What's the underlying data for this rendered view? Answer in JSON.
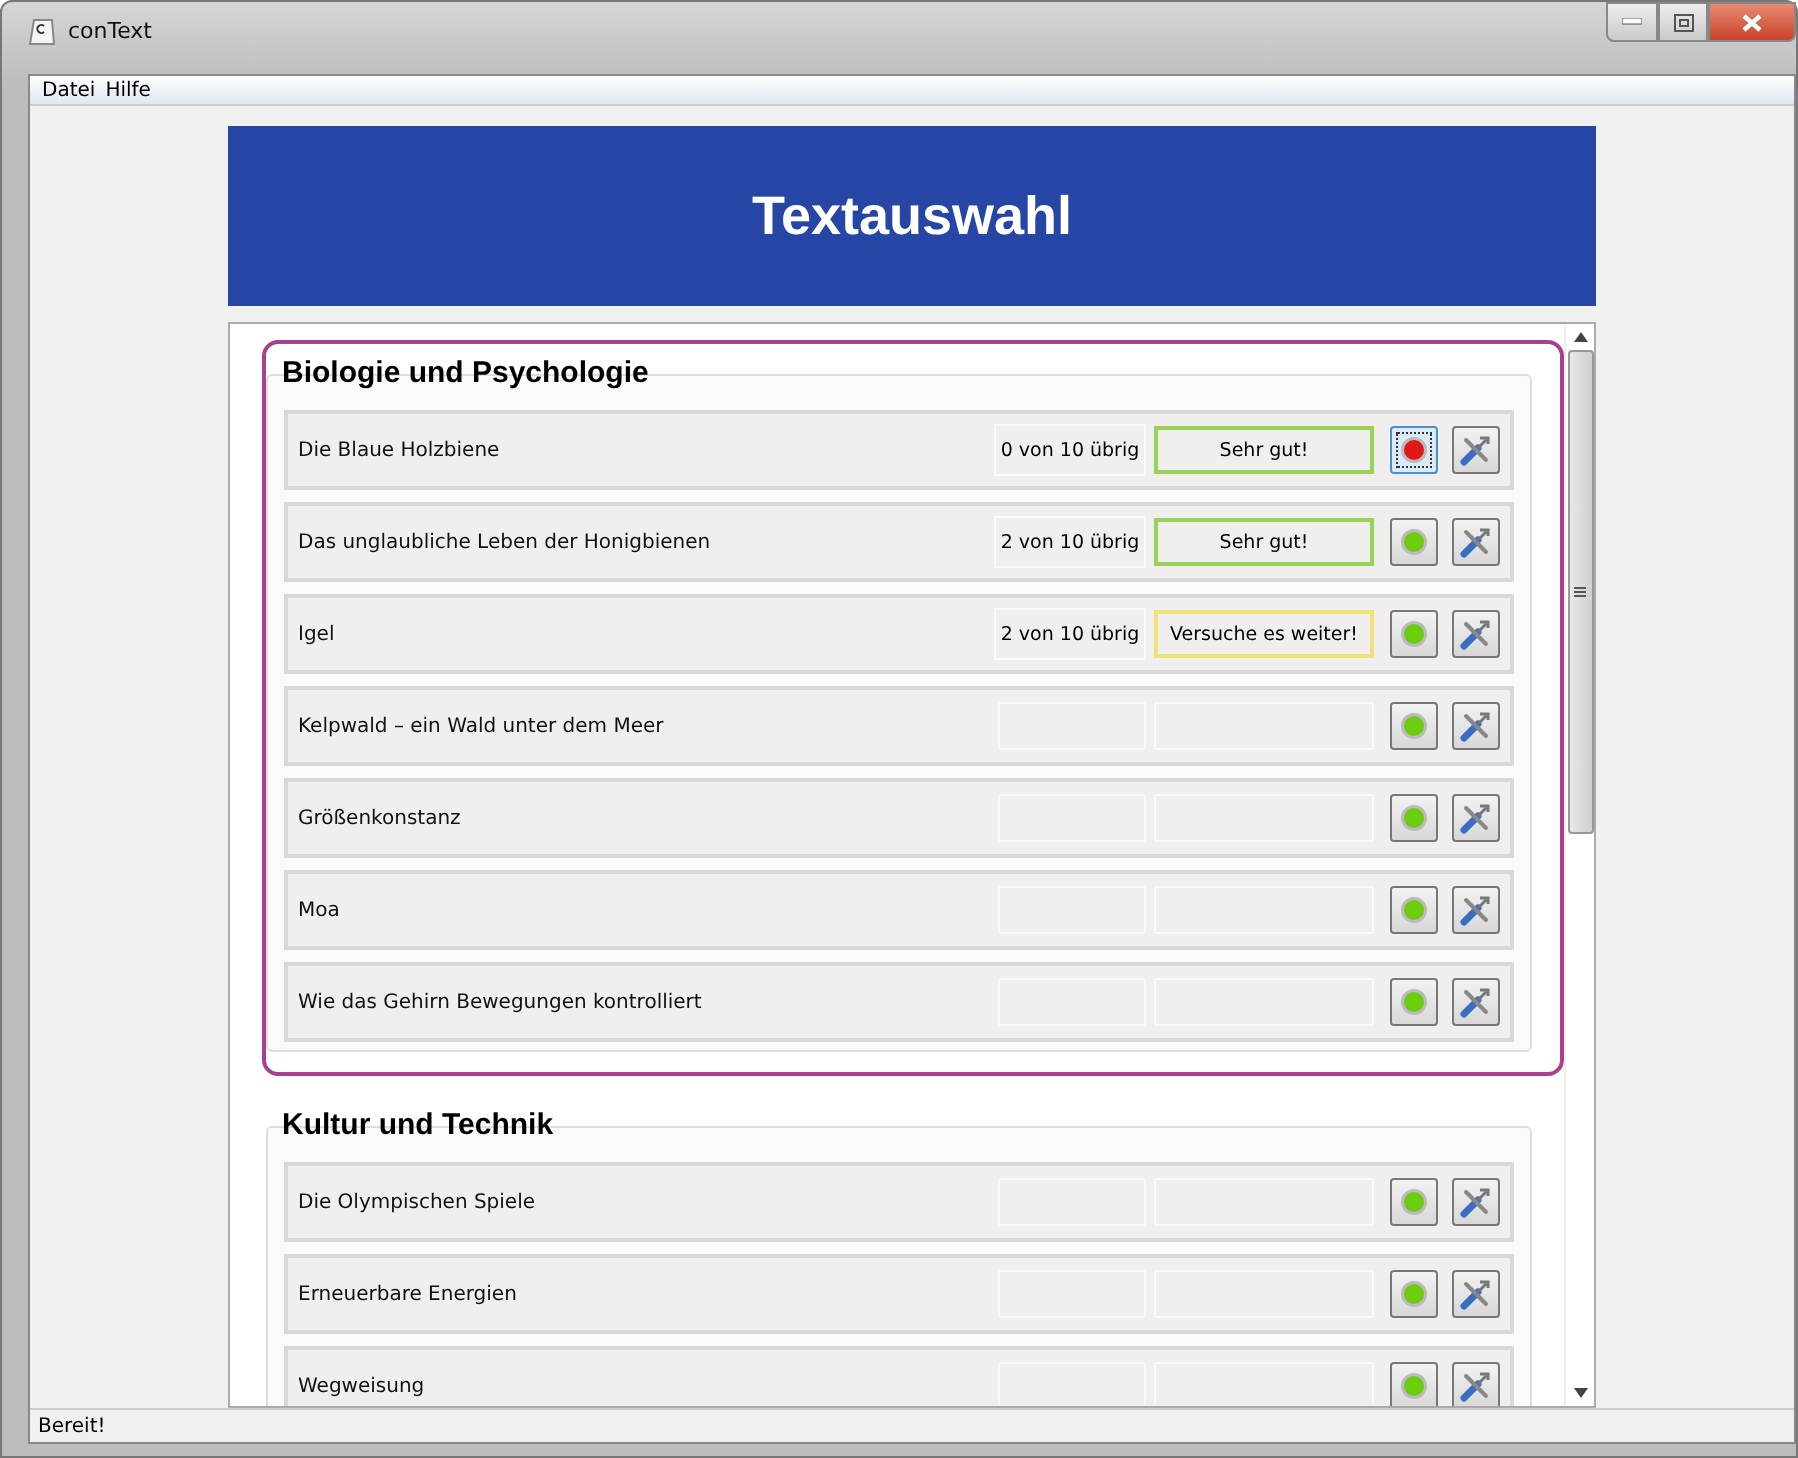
{
  "window": {
    "title": "conText"
  },
  "menu": [
    "Datei",
    "Hilfe"
  ],
  "header": {
    "title": "Textauswahl"
  },
  "groups": [
    {
      "title": "Biologie und Psychologie",
      "highlighted": true,
      "texts": [
        {
          "title": "Die Blaue Holzbiene",
          "remaining": "0 von 10 übrig",
          "feedback": {
            "text": "Sehr gut!",
            "kind": "good"
          },
          "color": "#e01818",
          "focused": true
        },
        {
          "title": "Das unglaubliche Leben der Honigbienen",
          "remaining": "2 von 10 übrig",
          "feedback": {
            "text": "Sehr gut!",
            "kind": "good"
          },
          "color": "#6ccc10",
          "focused": false
        },
        {
          "title": "Igel",
          "remaining": "2 von 10 übrig",
          "feedback": {
            "text": "Versuche es weiter!",
            "kind": "keep_trying"
          },
          "color": "#6ccc10",
          "focused": false
        },
        {
          "title": "Kelpwald – ein Wald unter dem Meer",
          "color": "#6ccc10",
          "focused": false
        },
        {
          "title": "Größenkonstanz",
          "color": "#6ccc10",
          "focused": false
        },
        {
          "title": "Moa",
          "color": "#6ccc10",
          "focused": false
        },
        {
          "title": "Wie das Gehirn Bewegungen kontrolliert",
          "color": "#6ccc10",
          "focused": false
        }
      ]
    },
    {
      "title": "Kultur und Technik",
      "highlighted": false,
      "texts": [
        {
          "title": "Die Olympischen Spiele",
          "color": "#6ccc10",
          "focused": false
        },
        {
          "title": "Erneuerbare Energien",
          "color": "#6ccc10",
          "focused": false
        },
        {
          "title": "Wegweisung",
          "color": "#6ccc10",
          "focused": false
        }
      ]
    }
  ],
  "status_bar": "Bereit!"
}
